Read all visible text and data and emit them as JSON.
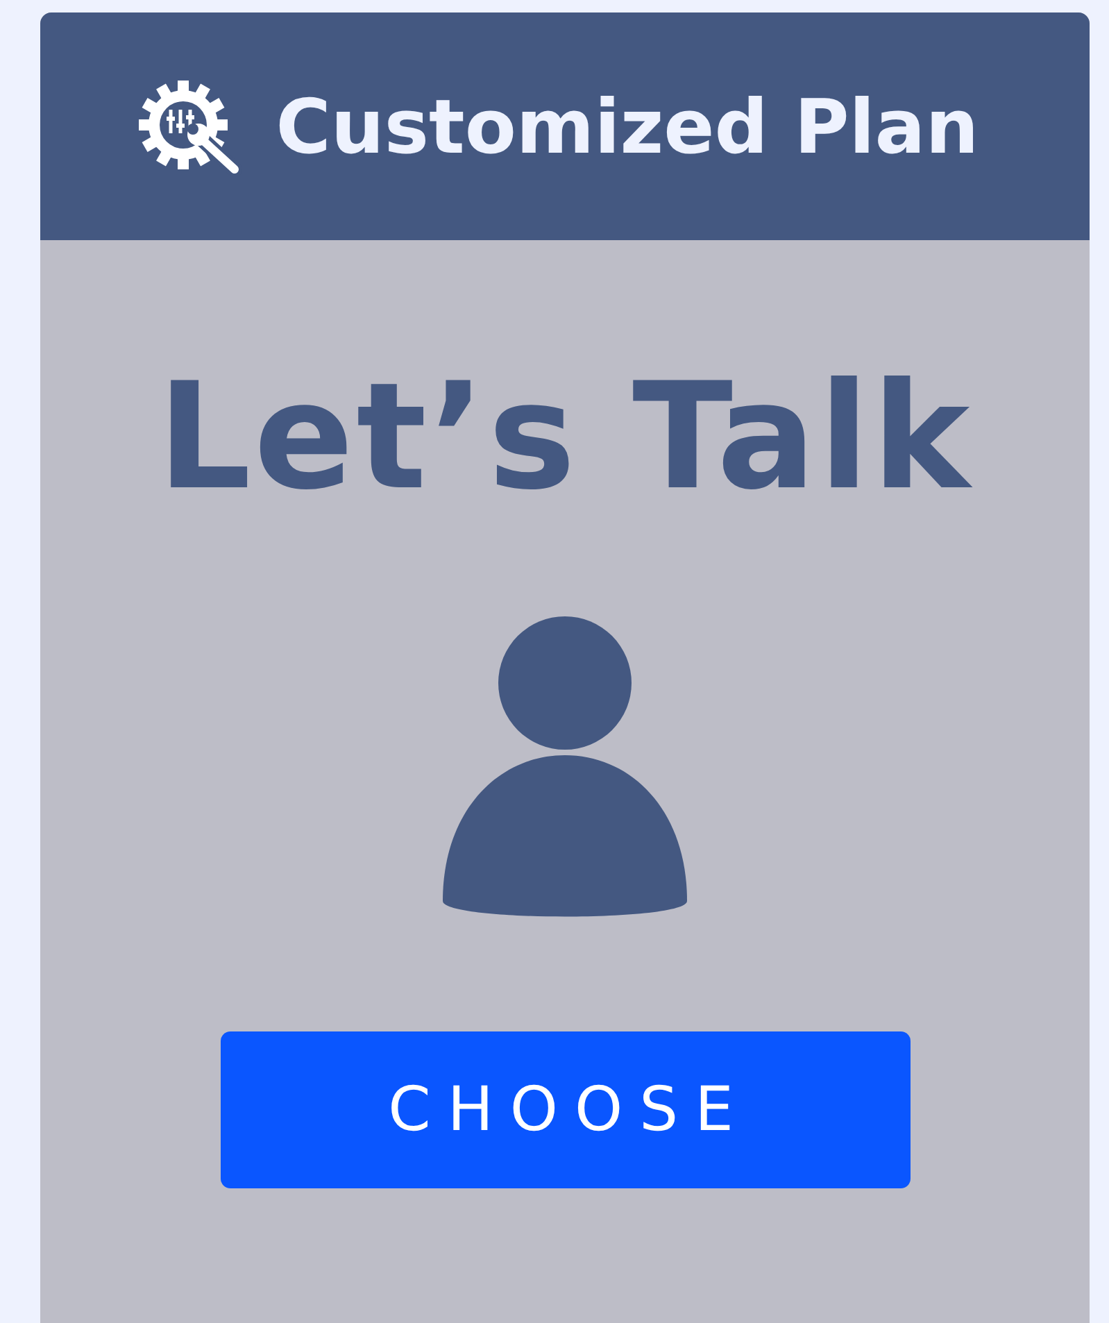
{
  "card": {
    "title": "Customized Plan",
    "heading": "Let’s Talk",
    "button": "CHOOSE"
  }
}
